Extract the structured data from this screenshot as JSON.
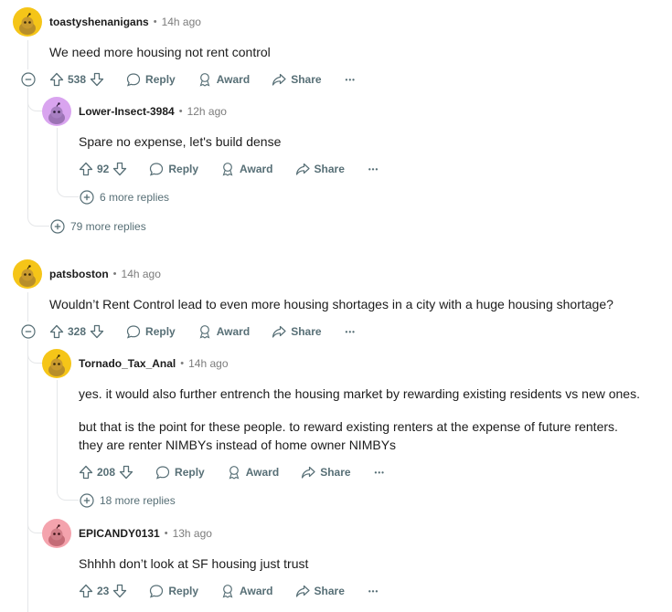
{
  "comments": [
    {
      "username": "toastyshenanigans",
      "time": "14h ago",
      "body": [
        "We need more housing not rent control"
      ],
      "score": "538",
      "more_replies": "79 more replies",
      "avatar_color": "#f5c518"
    },
    {
      "username": "Lower-Insect-3984",
      "time": "12h ago",
      "body": [
        "Spare no expense, let's build dense"
      ],
      "score": "92",
      "more_replies": "6 more replies",
      "avatar_color": "#d9a4ef"
    },
    {
      "username": "patsboston",
      "time": "14h ago",
      "body": [
        "Wouldn’t Rent Control lead to even more housing shortages in a city with a huge housing shortage?"
      ],
      "score": "328",
      "avatar_color": "#f5c518"
    },
    {
      "username": "Tornado_Tax_Anal",
      "time": "14h ago",
      "body": [
        "yes. it would also further entrench the housing market by rewarding existing residents vs new ones.",
        "but that is the point for these people. to reward existing renters at the expense of future renters.",
        "they are renter NIMBYs instead of home owner NIMBYs"
      ],
      "score": "208",
      "more_replies": "18 more replies",
      "avatar_color": "#f5c518"
    },
    {
      "username": "EPICANDY0131",
      "time": "13h ago",
      "body": [
        "Shhhh don’t look at SF housing just trust"
      ],
      "score": "23",
      "avatar_color": "#f4a3ad"
    }
  ],
  "actions": {
    "reply": "Reply",
    "award": "Award",
    "share": "Share",
    "more": "•••"
  },
  "dot_sep": "•",
  "icons": [
    "upvote-icon",
    "downvote-icon",
    "reply-icon",
    "award-icon",
    "share-icon",
    "collapse-icon",
    "expand-icon"
  ]
}
